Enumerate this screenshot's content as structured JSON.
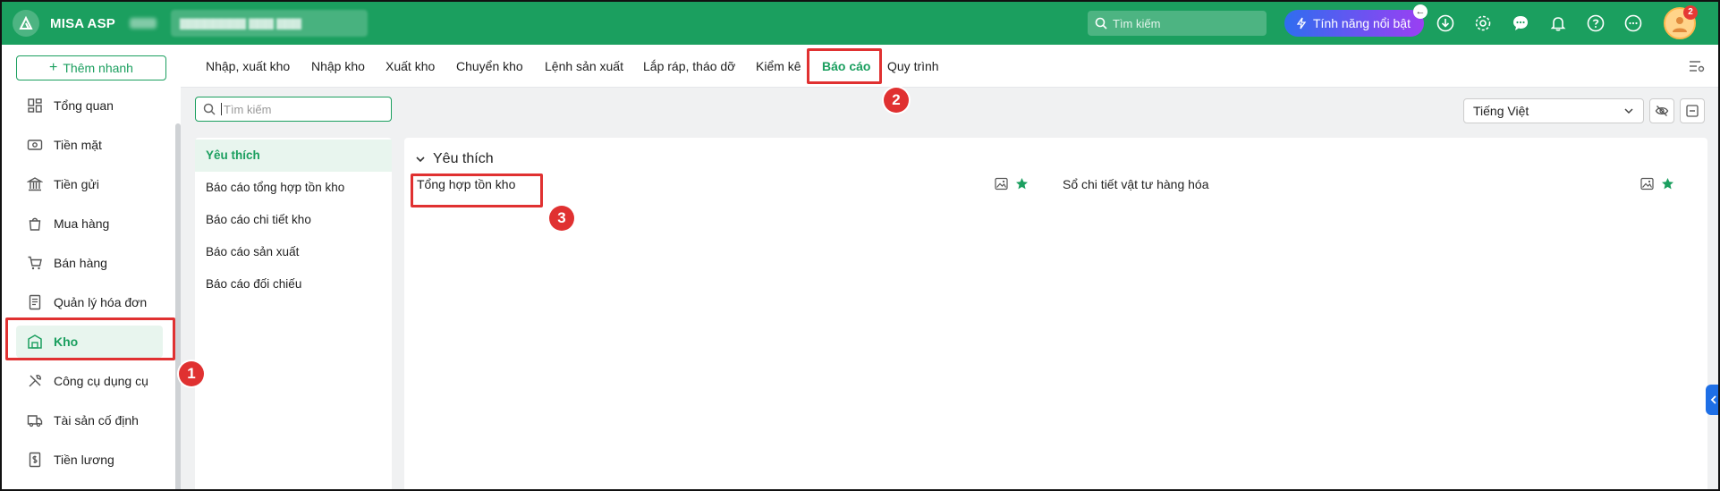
{
  "colors": {
    "brand": "#1b9f5f",
    "highlight": "#e03131",
    "feature_gradient_start": "#2f6df0",
    "feature_gradient_end": "#9b3ff2"
  },
  "header": {
    "app_name": "MISA ASP",
    "search_placeholder": "Tìm kiếm",
    "feature_button_label": "Tính năng nổi bật",
    "notification_count": "2",
    "icons": [
      "download-icon",
      "gear-icon",
      "chat-icon",
      "bell-icon",
      "help-icon",
      "more-icon"
    ]
  },
  "sidebar": {
    "quick_add_label": "Thêm nhanh",
    "items": [
      {
        "label": "Tổng quan",
        "icon": "dashboard-icon"
      },
      {
        "label": "Tiền mặt",
        "icon": "cash-icon"
      },
      {
        "label": "Tiền gửi",
        "icon": "bank-icon"
      },
      {
        "label": "Mua hàng",
        "icon": "shopping-bag-icon"
      },
      {
        "label": "Bán hàng",
        "icon": "cart-icon"
      },
      {
        "label": "Quản lý hóa đơn",
        "icon": "invoice-icon"
      },
      {
        "label": "Kho",
        "icon": "warehouse-icon",
        "active": true
      },
      {
        "label": "Công cụ dụng cụ",
        "icon": "tools-icon"
      },
      {
        "label": "Tài sản cố định",
        "icon": "truck-icon"
      },
      {
        "label": "Tiền lương",
        "icon": "salary-icon"
      }
    ]
  },
  "tabs": [
    {
      "label": "Nhập, xuất kho"
    },
    {
      "label": "Nhập kho"
    },
    {
      "label": "Xuất kho"
    },
    {
      "label": "Chuyển kho"
    },
    {
      "label": "Lệnh sản xuất"
    },
    {
      "label": "Lắp ráp, tháo dỡ"
    },
    {
      "label": "Kiểm kê"
    },
    {
      "label": "Báo cáo",
      "active": true
    },
    {
      "label": "Quy trình"
    }
  ],
  "toolbar": {
    "search_placeholder": "Tìm kiếm",
    "language": "Tiếng Việt"
  },
  "categories": [
    {
      "label": "Yêu thích",
      "active": true
    },
    {
      "label": "Báo cáo tổng hợp tồn kho"
    },
    {
      "label": "Báo cáo chi tiết kho"
    },
    {
      "label": "Báo cáo sản xuất"
    },
    {
      "label": "Báo cáo đối chiếu"
    }
  ],
  "report_group": {
    "title": "Yêu thích",
    "reports": [
      {
        "label": "Tổng hợp tồn kho",
        "favorite": true
      },
      {
        "label": "Sổ chi tiết vật tư hàng hóa",
        "favorite": true
      }
    ]
  },
  "annotations": {
    "step1": "1",
    "step2": "2",
    "step3": "3"
  }
}
